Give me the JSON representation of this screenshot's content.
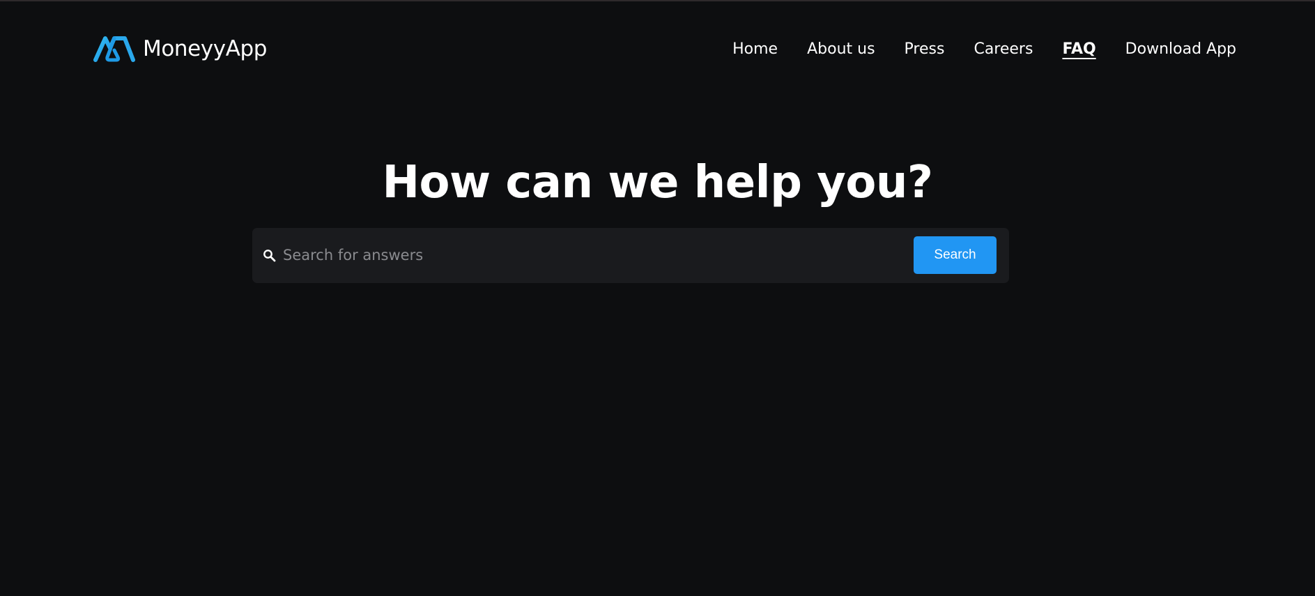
{
  "colors": {
    "background": "#0d0e10",
    "search_bar_bg": "#1a1b1e",
    "accent": "#2196f3",
    "logo_light": "#2fb3f0",
    "logo_dark": "#1a8fe0",
    "placeholder": "#8a8b8f",
    "text": "#ffffff"
  },
  "header": {
    "logo_icon": "moneyyapp-logo-icon",
    "logo_text": "MoneyyApp",
    "nav": [
      {
        "label": "Home",
        "active": false
      },
      {
        "label": "About us",
        "active": false
      },
      {
        "label": "Press",
        "active": false
      },
      {
        "label": "Careers",
        "active": false
      },
      {
        "label": "FAQ",
        "active": true
      },
      {
        "label": "Download App",
        "active": false
      }
    ]
  },
  "hero": {
    "title": "How can we help you?"
  },
  "search": {
    "icon": "search-icon",
    "placeholder": "Search for answers",
    "value": "",
    "button_label": "Search"
  }
}
